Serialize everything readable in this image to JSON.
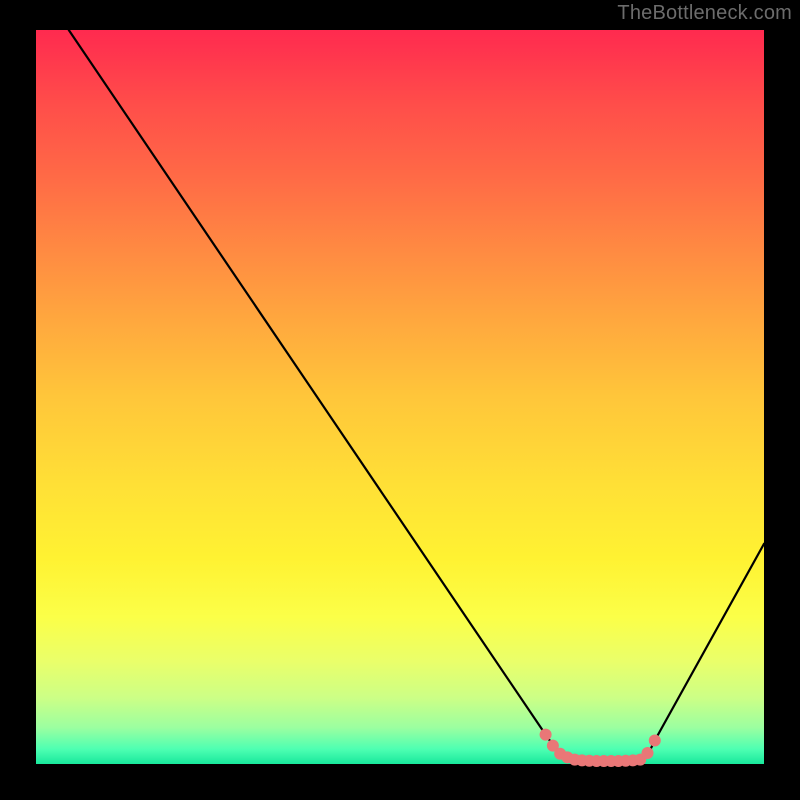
{
  "attribution": "TheBottleneck.com",
  "chart_data": {
    "type": "line",
    "title": "",
    "xlabel": "",
    "ylabel": "",
    "xlim": [
      0,
      100
    ],
    "ylim": [
      0,
      100
    ],
    "series": [
      {
        "name": "bottleneck-curve",
        "x": [
          4.5,
          70,
          72,
          74,
          76,
          78,
          80,
          82,
          84,
          85,
          100
        ],
        "y": [
          100,
          4,
          1.2,
          0.6,
          0.4,
          0.4,
          0.4,
          0.6,
          1.2,
          3.2,
          30
        ]
      }
    ],
    "markers": {
      "name": "bottom-cluster",
      "color": "#e97777",
      "points": [
        {
          "x": 70,
          "y": 4
        },
        {
          "x": 71,
          "y": 2.5
        },
        {
          "x": 72,
          "y": 1.4
        },
        {
          "x": 73,
          "y": 0.9
        },
        {
          "x": 74,
          "y": 0.6
        },
        {
          "x": 75,
          "y": 0.5
        },
        {
          "x": 76,
          "y": 0.45
        },
        {
          "x": 77,
          "y": 0.4
        },
        {
          "x": 78,
          "y": 0.4
        },
        {
          "x": 79,
          "y": 0.4
        },
        {
          "x": 80,
          "y": 0.4
        },
        {
          "x": 81,
          "y": 0.45
        },
        {
          "x": 82,
          "y": 0.5
        },
        {
          "x": 83,
          "y": 0.6
        },
        {
          "x": 84,
          "y": 1.5
        },
        {
          "x": 85,
          "y": 3.2
        }
      ]
    }
  }
}
